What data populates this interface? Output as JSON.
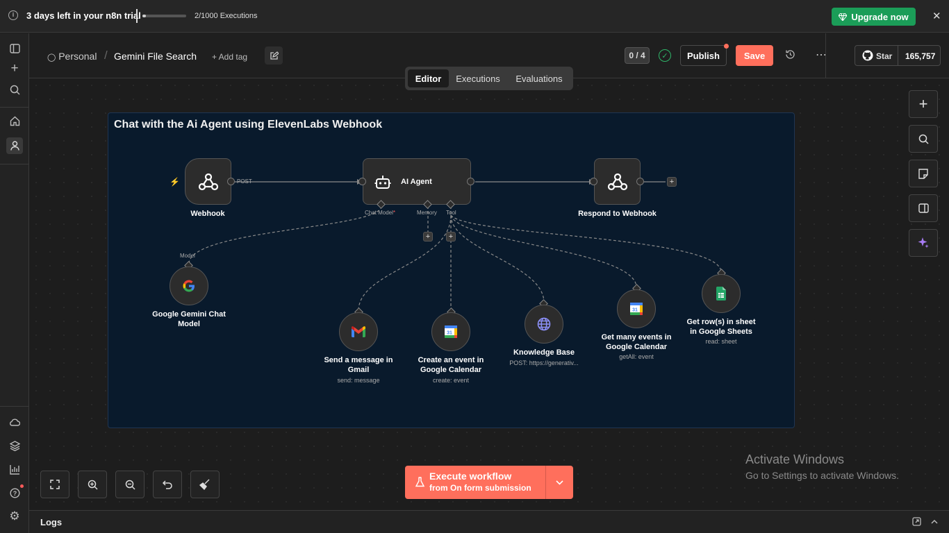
{
  "banner": {
    "trial_text": "3 days left in your n8n trial",
    "executions_text": "2/1000 Executions",
    "executions_used": 2,
    "executions_limit": 1000,
    "upgrade_label": "Upgrade now",
    "upgrade_color": "#1b9d58"
  },
  "header": {
    "project": "Personal",
    "workflow_name": "Gemini File Search",
    "add_tag": "+ Add tag",
    "counter": "0 / 4",
    "publish_label": "Publish",
    "save_label": "Save",
    "star_label": "Star",
    "star_count": "165,757"
  },
  "tabs": [
    {
      "label": "Editor",
      "active": true
    },
    {
      "label": "Executions",
      "active": false
    },
    {
      "label": "Evaluations",
      "active": false
    }
  ],
  "canvas": {
    "sticky_title": "Chat with the Ai Agent using ElevenLabs Webhook",
    "nodes": {
      "webhook": {
        "label": "Webhook",
        "port_label": "POST"
      },
      "agent": {
        "label": "AI Agent",
        "chat_model": "Chat Model",
        "required_mark": "*",
        "memory": "Memory",
        "tool": "Tool"
      },
      "respond": {
        "label": "Respond to Webhook"
      },
      "gemini": {
        "label_line1": "Google Gemini Chat",
        "label_line2": "Model",
        "port_label": "Model"
      },
      "gmail": {
        "label_line1": "Send a message in",
        "label_line2": "Gmail",
        "sub": "send: message"
      },
      "calendar_create": {
        "label_line1": "Create an event in",
        "label_line2": "Google Calendar",
        "sub": "create: event"
      },
      "knowledge": {
        "label": "Knowledge Base",
        "sub": "POST: https://generativ..."
      },
      "calendar_get": {
        "label_line1": "Get many events in",
        "label_line2": "Google Calendar",
        "sub": "getAll: event"
      },
      "sheets": {
        "label_line1": "Get row(s) in sheet",
        "label_line2": "in Google Sheets",
        "sub": "read: sheet"
      }
    }
  },
  "execute": {
    "title": "Execute workflow",
    "subtitle": "from On form submission",
    "color": "#ff6f5c"
  },
  "logs_label": "Logs",
  "watermark": {
    "line1": "Activate Windows",
    "line2": "Go to Settings to activate Windows."
  }
}
